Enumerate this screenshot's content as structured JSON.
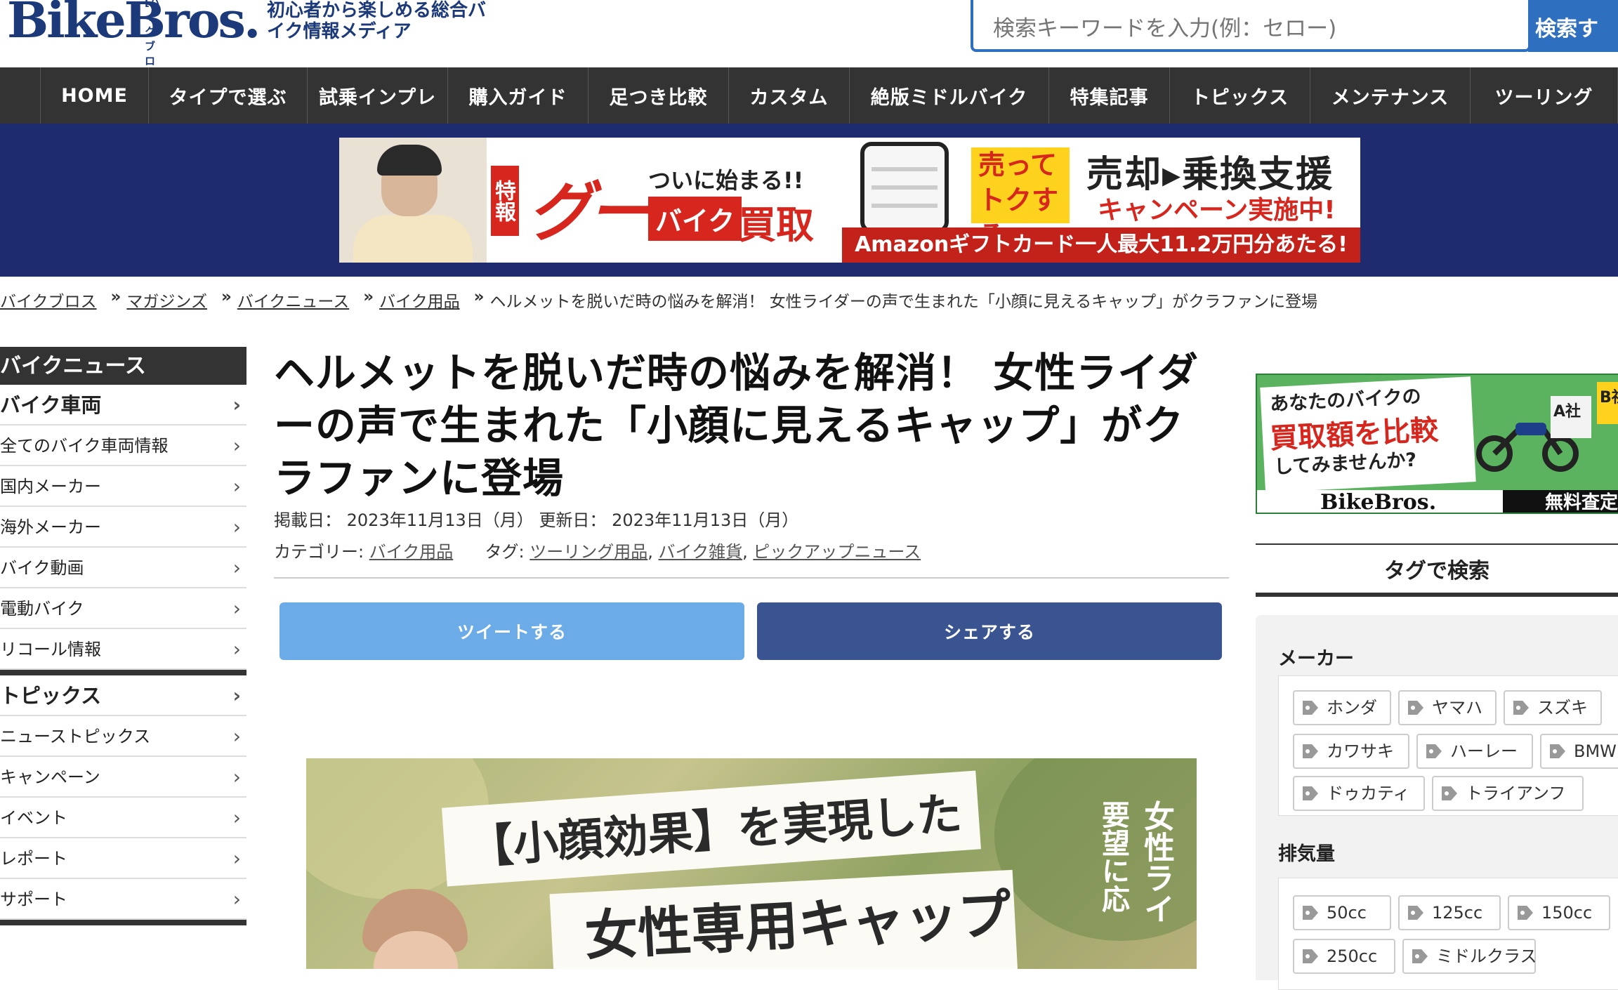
{
  "header": {
    "logo_text": "BikeBros.",
    "logo_ruby": "[バイクブロス]",
    "tagline": "初心者から楽しめる総合バイク情報メディア",
    "search_placeholder": "検索キーワードを入力(例：セロー)",
    "search_button": "検索す"
  },
  "nav": {
    "items": [
      "HOME",
      "タイプで選ぶ",
      "試乗インプレ",
      "購入ガイド",
      "足つき比較",
      "カスタム",
      "絶版ミドルバイク",
      "特集記事",
      "トピックス",
      "メンテナンス",
      "ツーリング"
    ]
  },
  "promo_banner": {
    "special": "特報",
    "goo": "グー",
    "tsuini": "ついに始まる!!",
    "bike": "バイク",
    "kaitori": "買取",
    "uritte": "売って\nトクする",
    "headline": "売却▸乗換支援",
    "campaign": "キャンペーン実施中!",
    "amazon": "Amazonギフトカード一人最大11.2万円分あたる!"
  },
  "breadcrumb": {
    "items": [
      "バイクブロス",
      "マガジンズ",
      "バイクニュース",
      "バイク用品"
    ],
    "separator": "»",
    "current": "ヘルメットを脱いだ時の悩みを解消！ 女性ライダーの声で生まれた「小顔に見えるキャップ」がクラファンに登場"
  },
  "left_sidebar": {
    "heading": "バイクニュース",
    "group1": [
      "バイク車両",
      "全てのバイク車両情報",
      "国内メーカー",
      "海外メーカー",
      "バイク動画",
      "電動バイク",
      "リコール情報"
    ],
    "group2": [
      "トピックス",
      "ニューストピックス",
      "キャンペーン",
      "イベント",
      "レポート",
      "サポート"
    ]
  },
  "article": {
    "title": "ヘルメットを脱いだ時の悩みを解消！ 女性ライダーの声で生まれた「小顔に見えるキャップ」がクラファンに登場",
    "posted_label": "掲載日：",
    "posted_date": "2023年11月13日（月）",
    "updated_label": "更新日：",
    "updated_date": "2023年11月13日（月）",
    "category_label": "カテゴリー:",
    "category": "バイク用品",
    "tags_label": "タグ:",
    "tags": [
      "ツーリング用品",
      "バイク雑貨",
      "ピックアップニュース"
    ],
    "tweet_button": "ツイートする",
    "share_button": "シェアする",
    "hero_line1": "【小顔効果】を実現した",
    "hero_line2": "女性専用キャップ",
    "hero_vert1": "女性ライ",
    "hero_vert2": "要望に応"
  },
  "right_sidebar": {
    "ad": {
      "line1": "あなたのバイクの",
      "line2": "買取額を比較",
      "line3": "してみませんか?",
      "brand": "BikeBros.",
      "free": "無料査定",
      "badge_a": "A社",
      "badge_b": "B社"
    },
    "tag_search_title": "タグで検索",
    "maker_title": "メーカー",
    "makers": [
      "ホンダ",
      "ヤマハ",
      "スズキ",
      "カワサキ",
      "ハーレー",
      "BMW",
      "ドゥカティ",
      "トライアンフ"
    ],
    "displacement_title": "排気量",
    "displacements": [
      "50cc",
      "125cc",
      "150cc",
      "250cc",
      "ミドルクラス"
    ]
  }
}
